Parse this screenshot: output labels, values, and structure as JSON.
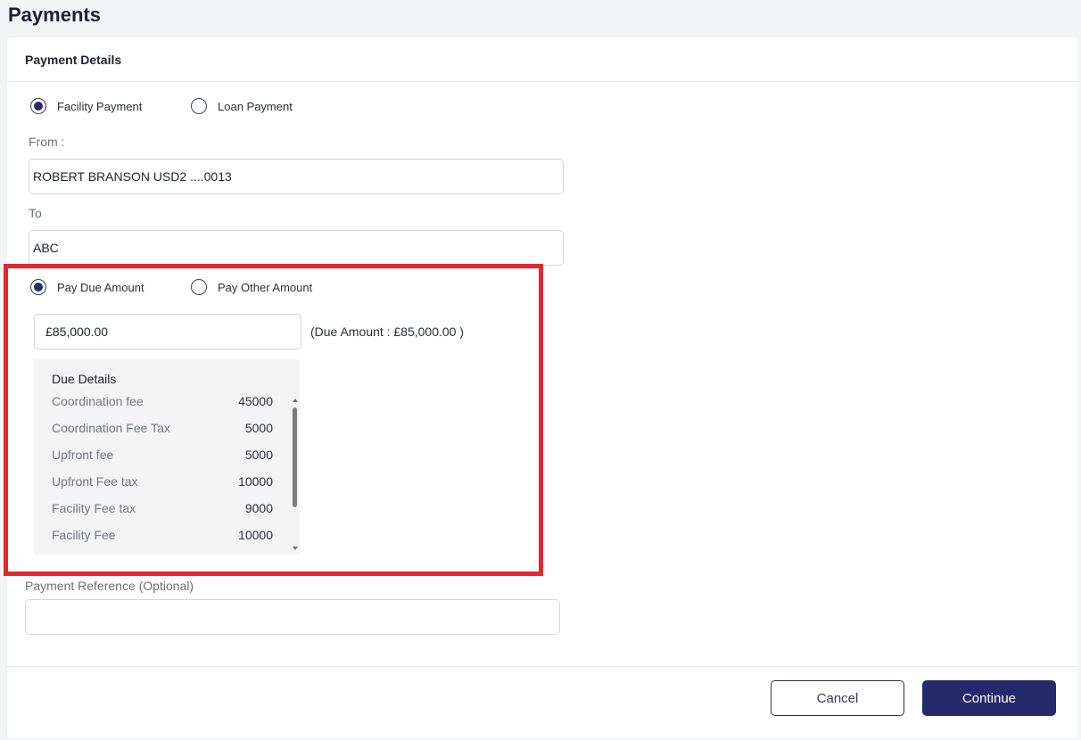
{
  "page": {
    "title": "Payments"
  },
  "card": {
    "header": "Payment Details"
  },
  "payment_type": {
    "options": [
      {
        "label": "Facility Payment",
        "selected": true
      },
      {
        "label": "Loan Payment",
        "selected": false
      }
    ]
  },
  "from": {
    "label": "From :",
    "value": "ROBERT BRANSON USD2 ....0013"
  },
  "to": {
    "label": "To",
    "value": "ABC"
  },
  "amount_type": {
    "options": [
      {
        "label": "Pay Due Amount",
        "selected": true
      },
      {
        "label": "Pay Other Amount",
        "selected": false
      }
    ]
  },
  "amount": {
    "value": "£85,000.00",
    "due_note": "(Due Amount : £85,000.00 )"
  },
  "due_details": {
    "title": "Due Details",
    "rows": [
      {
        "label": "Coordination fee",
        "value": "45000"
      },
      {
        "label": "Coordination Fee Tax",
        "value": "5000"
      },
      {
        "label": "Upfront fee",
        "value": "5000"
      },
      {
        "label": "Upfront Fee tax",
        "value": "10000"
      },
      {
        "label": "Facility Fee tax",
        "value": "9000"
      },
      {
        "label": "Facility Fee",
        "value": "10000"
      }
    ]
  },
  "reference": {
    "label": "Payment Reference (Optional)",
    "value": ""
  },
  "buttons": {
    "cancel": "Cancel",
    "continue": "Continue"
  },
  "colors": {
    "primary": "#262a6b",
    "highlight": "#e5262e"
  }
}
